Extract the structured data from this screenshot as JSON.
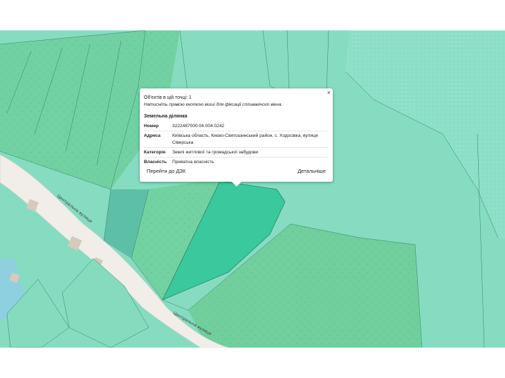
{
  "map": {
    "street_labels": [
      "Центральна вулиця",
      "Центральна вулиця"
    ],
    "colors": {
      "parcel_fill": "#6fcf9c",
      "parcel_light": "#85dcbd",
      "selected_parcel": "#39c99c",
      "road": "#f1eeea",
      "building": "#d6c9bd",
      "water_blue": "#8ecfe0",
      "boundary": "#2f7f6a"
    }
  },
  "popup": {
    "object_count": "Об'єктів в цій точці: 1",
    "hint": "Натисніть правою кнопкою миші для фіксації спливаючого вікна.",
    "section_title": "Земельна ділянка",
    "rows": [
      {
        "key": "Номер",
        "value": "3222487000:04:004:0242"
      },
      {
        "key": "Адреса",
        "value": "Київська область, Києво-Святошинський район, с. Ходосівка, вулиця Сіверська"
      },
      {
        "key": "Категорія",
        "value": "Землі житлової та громадської забудови"
      },
      {
        "key": "Власність",
        "value": "Приватна власність"
      }
    ],
    "link_dzk": "Перейти до ДЗК",
    "link_details": "Детальніше",
    "close_symbol": "×"
  }
}
